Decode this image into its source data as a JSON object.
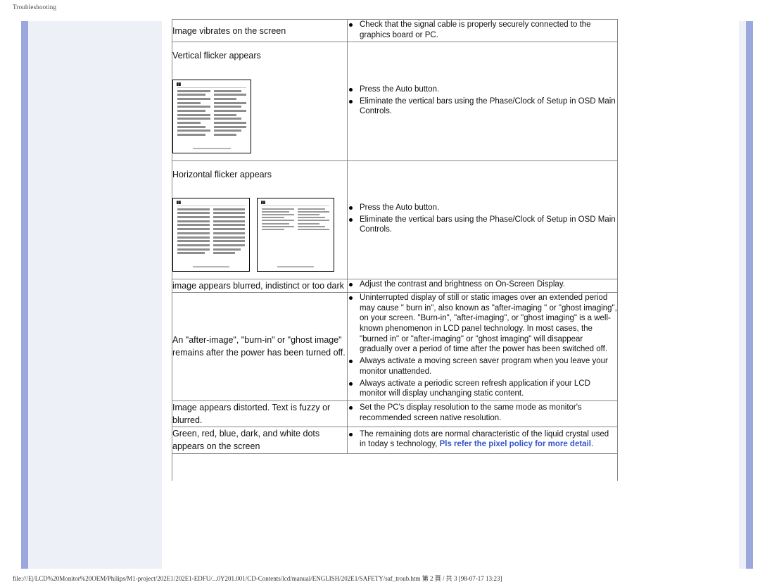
{
  "header": {
    "breadcrumb": "Troubleshooting"
  },
  "footer": {
    "path": "file:///E|/LCD%20Monitor%20OEM/Philips/M1-project/202E1/202E1-EDFU/...0Y201.001/CD-Contents/lcd/manual/ENGLISH/202E1/SAFETY/saf_troub.htm 第 2 頁 / 共 3 [98-07-17 13:23]"
  },
  "colors": {
    "link": "#3355cc",
    "accent_bar": "#9aa8de",
    "panel": "#eef0f7",
    "table_border": "#888888"
  },
  "table": {
    "rows": [
      {
        "symptom": "Image vibrates on the screen",
        "has_thumbs": false,
        "thumb_count": 0,
        "bullets": [
          "Check that the signal cable is properly securely connected to the graphics board or PC."
        ]
      },
      {
        "symptom": "Vertical flicker appears",
        "has_thumbs": true,
        "thumb_count": 1,
        "bullets": [
          "Press the Auto button.",
          "Eliminate the vertical bars using the Phase/Clock of Setup in OSD Main Controls."
        ]
      },
      {
        "symptom": "Horizontal flicker appears",
        "has_thumbs": true,
        "thumb_count": 2,
        "bullets": [
          "Press the Auto button.",
          "Eliminate the vertical bars using the Phase/Clock of Setup in OSD Main Controls."
        ]
      },
      {
        "symptom": "image appears blurred, indistinct or too dark",
        "has_thumbs": false,
        "thumb_count": 0,
        "bullets": [
          "Adjust the contrast and brightness on On-Screen Display."
        ]
      },
      {
        "symptom": "An \"after-image\", \"burn-in\" or \"ghost image\" remains after the power has been turned off.",
        "has_thumbs": false,
        "thumb_count": 0,
        "bullets": [
          "Uninterrupted display of still or static images over an extended period may cause \" burn in\", also known as \"after-imaging \" or \"ghost imaging\", on your screen. \"Burn-in\", \"after-imaging\", or \"ghost imaging\" is a well-known phenomenon in LCD panel technology. In most cases, the \"burned in\" or \"after-imaging\" or \"ghost imaging\" will disappear gradually over a period of time after the power has been switched off.",
          "Always activate a moving screen saver program when you leave your monitor unattended.",
          "Always activate a periodic screen refresh application if your LCD monitor will display unchanging static content."
        ]
      },
      {
        "symptom": "Image appears distorted. Text  is fuzzy or blurred.",
        "has_thumbs": false,
        "thumb_count": 0,
        "bullets": [
          "Set the PC's display resolution to the same mode as monitor's recommended screen native resolution."
        ]
      },
      {
        "symptom": "Green, red, blue, dark, and white dots appears on the screen",
        "has_thumbs": false,
        "thumb_count": 0,
        "bullets": [],
        "rich_bullet": {
          "text_before": "The remaining dots are normal characteristic of the liquid crystal used in today s technology, ",
          "link_text": "Pls refer the pixel policy for more detail",
          "text_after": "."
        }
      }
    ]
  }
}
